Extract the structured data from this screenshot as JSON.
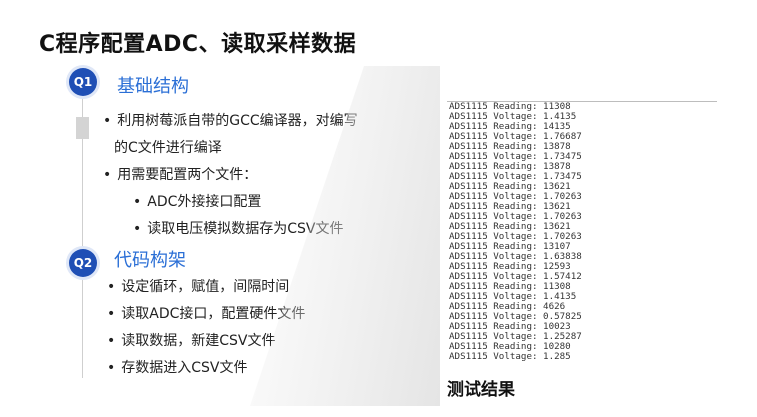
{
  "title": "C程序配置ADC、读取采样数据",
  "sections": [
    {
      "badge": "Q1",
      "title": "基础结构",
      "bullets": [
        {
          "line1": "利用树莓派自带的GCC编译器，对编写",
          "line2": "的C文件进行编译"
        },
        {
          "text": "用需要配置两个文件："
        },
        {
          "text": "ADC外接接口配置"
        },
        {
          "text": "读取电压模拟数据存为CSV文件"
        }
      ]
    },
    {
      "badge": "Q2",
      "title": "代码构架",
      "bullets": [
        {
          "text": "设定循环，赋值，间隔时间"
        },
        {
          "text": "读取ADC接口，配置硬件文件"
        },
        {
          "text": "读取数据，新建CSV文件"
        },
        {
          "text": "存数据进入CSV文件"
        }
      ]
    }
  ],
  "bullet_symbol": "•",
  "terminal_lines": [
    "ADS1115 Reading: 11308",
    "ADS1115 Voltage: 1.4135",
    "ADS1115 Reading: 14135",
    "ADS1115 Voltage: 1.76687",
    "ADS1115 Reading: 13878",
    "ADS1115 Voltage: 1.73475",
    "ADS1115 Reading: 13878",
    "ADS1115 Voltage: 1.73475",
    "ADS1115 Reading: 13621",
    "ADS1115 Voltage: 1.70263",
    "ADS1115 Reading: 13621",
    "ADS1115 Voltage: 1.70263",
    "ADS1115 Reading: 13621",
    "ADS1115 Voltage: 1.70263",
    "ADS1115 Reading: 13107",
    "ADS1115 Voltage: 1.63838",
    "ADS1115 Reading: 12593",
    "ADS1115 Voltage: 1.57412",
    "ADS1115 Reading: 11308",
    "ADS1115 Voltage: 1.4135",
    "ADS1115 Reading: 4626",
    "ADS1115 Voltage: 0.57825",
    "ADS1115 Reading: 10023",
    "ADS1115 Voltage: 1.25287",
    "ADS1115 Reading: 10280",
    "ADS1115 Voltage: 1.285"
  ],
  "caption": "测试结果",
  "colors": {
    "badge": "#1f4fb5",
    "section_title": "#2b6fd6"
  }
}
